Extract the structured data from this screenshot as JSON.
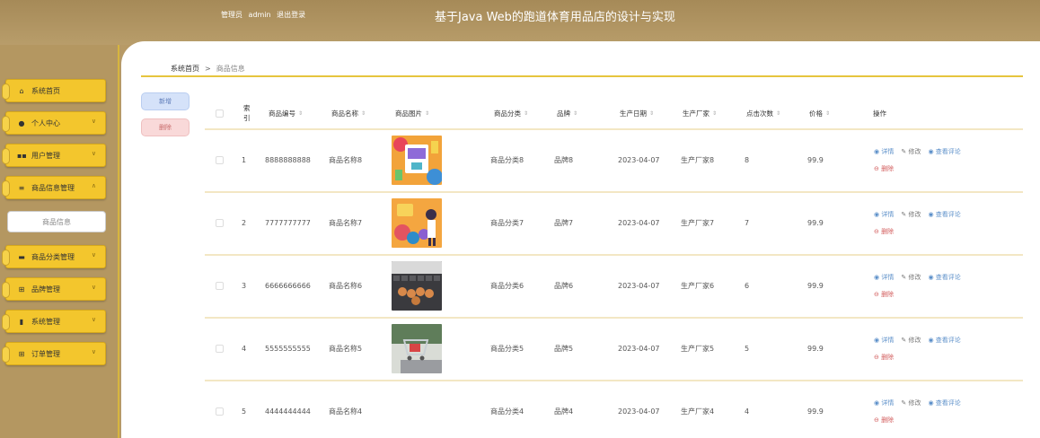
{
  "header": {
    "user_role": "管理员",
    "username": "admin",
    "logout": "退出登录",
    "title": "基于Java Web的跑道体育用品店的设计与实现"
  },
  "sidebar": {
    "items": [
      {
        "label": "系统首页",
        "icon": "home-icon"
      },
      {
        "label": "个人中心",
        "icon": "person-icon"
      },
      {
        "label": "用户管理",
        "icon": "users-icon"
      },
      {
        "label": "商品信息管理",
        "icon": "list-icon"
      },
      {
        "label": "商品分类管理",
        "icon": "folder-icon"
      },
      {
        "label": "品牌管理",
        "icon": "grid-icon"
      },
      {
        "label": "系统管理",
        "icon": "chart-icon"
      },
      {
        "label": "订单管理",
        "icon": "grid-icon"
      }
    ],
    "submenu_item": "商品信息"
  },
  "breadcrumb": {
    "home": "系统首页",
    "separator": ">",
    "current": "商品信息"
  },
  "buttons": {
    "add": "新增",
    "delete": "删除"
  },
  "table": {
    "headers": {
      "index": "索引",
      "code": "商品编号",
      "name": "商品名称",
      "image": "商品图片",
      "category": "商品分类",
      "brand": "品牌",
      "date": "生产日期",
      "maker": "生产厂家",
      "clicks": "点击次数",
      "price": "价格",
      "actions": "操作"
    },
    "action_labels": {
      "detail": "详情",
      "edit": "修改",
      "comments": "查看评论",
      "delete": "删除"
    },
    "rows": [
      {
        "index": "1",
        "code": "8888888888",
        "name": "商品名称8",
        "image": "shopping-illustration",
        "category": "商品分类8",
        "brand": "品牌8",
        "date": "2023-04-07",
        "maker": "生产厂家8",
        "clicks": "8",
        "price": "99.9"
      },
      {
        "index": "2",
        "code": "7777777777",
        "name": "商品名称7",
        "image": "shopping-illustration",
        "category": "商品分类7",
        "brand": "品牌7",
        "date": "2023-04-07",
        "maker": "生产厂家7",
        "clicks": "7",
        "price": "99.9"
      },
      {
        "index": "3",
        "code": "6666666666",
        "name": "商品名称6",
        "image": "keyboard-cart-photo",
        "category": "商品分类6",
        "brand": "品牌6",
        "date": "2023-04-07",
        "maker": "生产厂家6",
        "clicks": "6",
        "price": "99.9"
      },
      {
        "index": "4",
        "code": "5555555555",
        "name": "商品名称5",
        "image": "cart-laptop-photo",
        "category": "商品分类5",
        "brand": "品牌5",
        "date": "2023-04-07",
        "maker": "生产厂家5",
        "clicks": "5",
        "price": "99.9"
      },
      {
        "index": "5",
        "code": "4444444444",
        "name": "商品名称4",
        "image": "",
        "category": "商品分类4",
        "brand": "品牌4",
        "date": "2023-04-07",
        "maker": "生产厂家4",
        "clicks": "4",
        "price": "99.9"
      }
    ]
  },
  "colors": {
    "accent": "#f3c62d",
    "header_bg": "#b89d6a",
    "sidebar_bg": "#b49761",
    "link_blue": "#5b8fc9",
    "delete_red": "#d25c5c"
  }
}
